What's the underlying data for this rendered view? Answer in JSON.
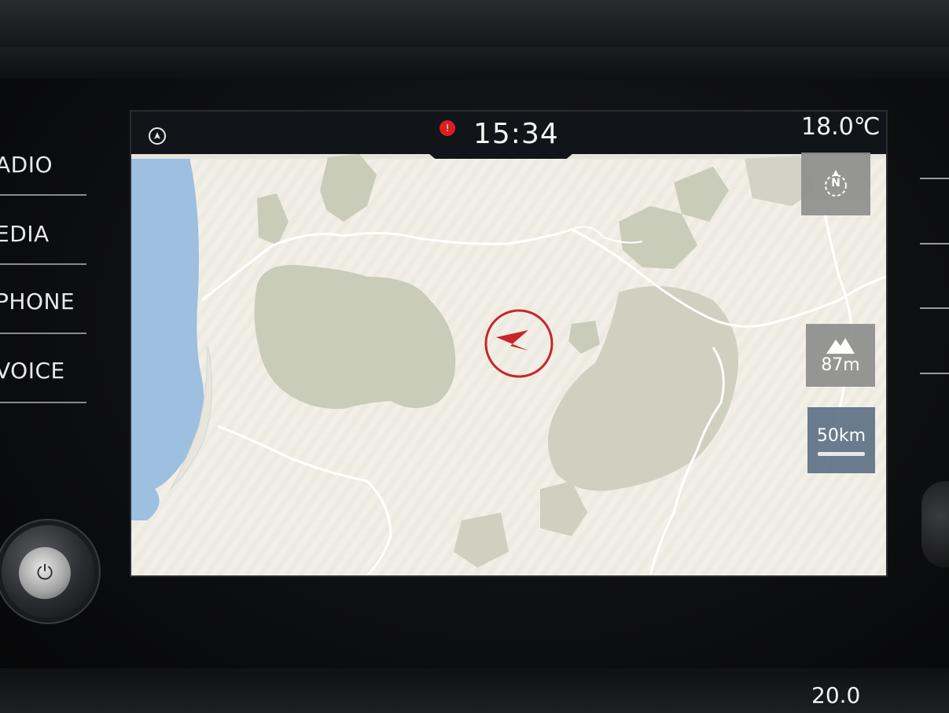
{
  "side_menu": {
    "items": [
      {
        "label": "ADIO"
      },
      {
        "label": "EDIA"
      },
      {
        "label": "PHONE"
      },
      {
        "label": "VOICE"
      }
    ]
  },
  "status_bar": {
    "time": "15:34",
    "temperature": "18.0℃"
  },
  "map_controls": {
    "compass_label": "N",
    "altitude": "87m",
    "scale": "50km"
  },
  "climate": {
    "bottom_temp": "20.0"
  },
  "colors": {
    "water": "#9dbfe0",
    "land": "#ecebe2",
    "forest": "#c8cbb8",
    "border": "#ffffff",
    "position_marker": "#c8262b",
    "status_bar": "#111418"
  },
  "icons": {
    "position": "navigation-arrow-icon",
    "compass": "compass-icon",
    "altitude": "mountain-icon",
    "alert": "alert-icon",
    "nav_status": "navigation-status-icon"
  }
}
